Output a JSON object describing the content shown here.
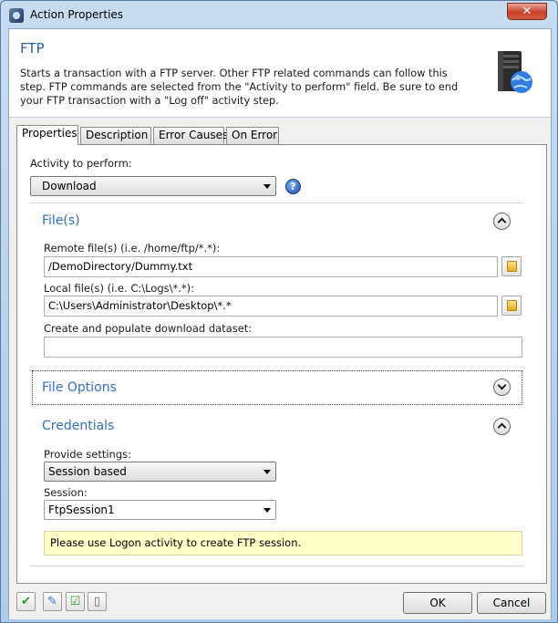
{
  "window": {
    "title": "Action Properties",
    "close_glyph": "✕"
  },
  "header": {
    "title": "FTP",
    "description": "Starts a transaction with a FTP server. Other FTP related commands can follow this step. FTP commands are selected from the \"Activity to perform\" field. Be sure to end your FTP transaction with a \"Log off\" activity step.",
    "icon": "ftp-server-globe-icon"
  },
  "tabs": [
    {
      "label": "Properties",
      "active": true
    },
    {
      "label": "Description",
      "active": false
    },
    {
      "label": "Error Causes",
      "active": false
    },
    {
      "label": "On Error",
      "active": false
    }
  ],
  "activity": {
    "label": "Activity to perform:",
    "value": "Download",
    "help_glyph": "?"
  },
  "files_section": {
    "title": "File(s)",
    "remote_label": "Remote file(s) (i.e. /home/ftp/*.*):",
    "remote_value": "/DemoDirectory/Dummy.txt",
    "local_label": "Local file(s) (i.e. C:\\Logs\\*.*):",
    "local_value": "C:\\Users\\Administrator\\Desktop\\*.*",
    "dataset_label": "Create and populate download dataset:",
    "dataset_value": ""
  },
  "file_options_section": {
    "title": "File Options",
    "expanded": false
  },
  "credentials_section": {
    "title": "Credentials",
    "provide_label": "Provide settings:",
    "provide_value": "Session based",
    "session_label": "Session:",
    "session_value": "FtpSession1",
    "info_text": "Please use Logon activity to create FTP session."
  },
  "footer": {
    "icons": [
      "check-icon",
      "edit-icon",
      "verify-icon",
      "page-icon"
    ],
    "ok_label": "OK",
    "cancel_label": "Cancel"
  },
  "colors": {
    "accent": "#2f6fbf",
    "info_background": "#ffffc8",
    "titlebar": "#b9d1ea"
  }
}
